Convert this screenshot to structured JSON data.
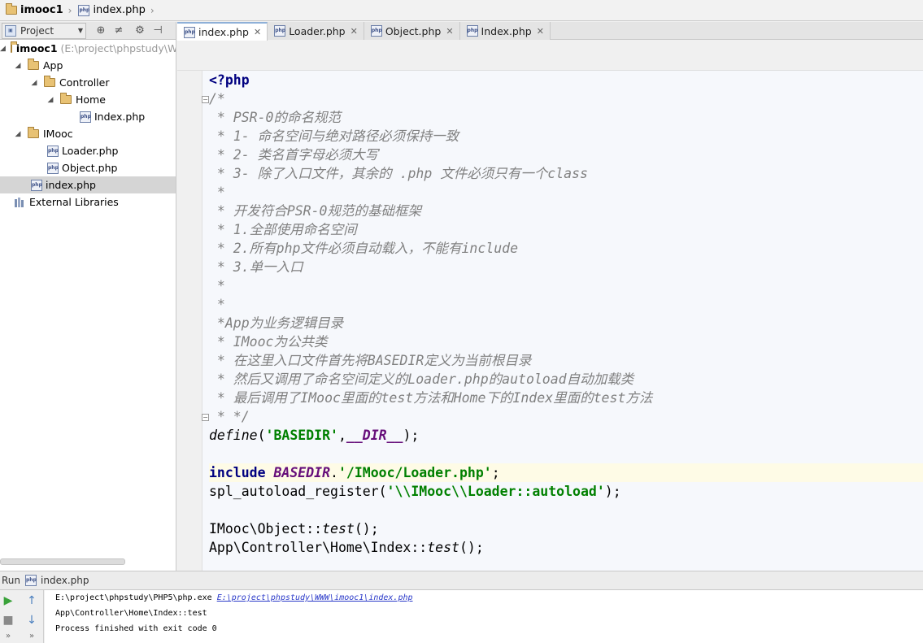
{
  "breadcrumb": {
    "project": "imooc1",
    "file": "index.php"
  },
  "project_panel": {
    "view_selector": "Project",
    "tree": [
      {
        "label": "imooc1",
        "path": "(E:\\project\\phpstudy\\W",
        "type": "folder",
        "expanded": true
      },
      {
        "label": "App",
        "type": "folder",
        "expanded": true
      },
      {
        "label": "Controller",
        "type": "folder",
        "expanded": true
      },
      {
        "label": "Home",
        "type": "folder",
        "expanded": true
      },
      {
        "label": "Index.php",
        "type": "php-file"
      },
      {
        "label": "IMooc",
        "type": "folder",
        "expanded": true
      },
      {
        "label": "Loader.php",
        "type": "php-file"
      },
      {
        "label": "Object.php",
        "type": "php-file"
      },
      {
        "label": "index.php",
        "type": "php-file",
        "selected": true
      },
      {
        "label": "External Libraries",
        "type": "library"
      }
    ]
  },
  "tabs": [
    {
      "label": "index.php",
      "active": true
    },
    {
      "label": "Loader.php"
    },
    {
      "label": "Object.php"
    },
    {
      "label": "Index.php"
    }
  ],
  "editor": {
    "lines": [
      "<?php",
      "/*",
      " * PSR-0的命名规范",
      " * 1- 命名空间与绝对路径必须保持一致",
      " * 2- 类名首字母必须大写",
      " * 3- 除了入口文件，其余的 .php 文件必须只有一个class",
      " *",
      " * 开发符合PSR-0规范的基础框架",
      " * 1.全部使用命名空间",
      " * 2.所有php文件必须自动载入，不能有include",
      " * 3.单一入口",
      " *",
      " *",
      " *App为业务逻辑目录",
      " * IMooc为公共类",
      " * 在这里入口文件首先将BASEDIR定义为当前根目录",
      " * 然后又调用了命名空间定义的Loader.php的autoload自动加载类",
      " * 最后调用了IMooc里面的test方法和Home下的Index里面的test方法",
      " * */",
      "define('BASEDIR',__DIR__);",
      "",
      "include BASEDIR.'/IMooc/Loader.php';",
      "spl_autoload_register('\\\\IMooc\\\\Loader::autoload');",
      "",
      "IMooc\\Object::test();",
      "App\\Controller\\Home\\Index::test();"
    ],
    "tokens": {
      "php_open": "<?php",
      "define_fn": "define",
      "define_open": "(",
      "define_arg": "'BASEDIR'",
      "comma": ",",
      "dir_const": "__DIR__",
      "define_close": ");",
      "include_kw": "include",
      "basedir_const": "BASEDIR",
      "dot": ".",
      "include_path": "'/IMooc/Loader.php'",
      "semicolon": ";",
      "spl_fn": "spl_autoload_register(",
      "spl_arg": "'\\\\IMooc\\\\Loader::autoload'",
      "spl_close": ");",
      "call1_class": "IMooc\\Object::",
      "call1_method": "test",
      "call1_end": "();",
      "call2_class": "App\\Controller\\Home\\Index::",
      "call2_method": "test",
      "call2_end": "();"
    }
  },
  "run_panel": {
    "label": "Run",
    "config_file": "index.php",
    "console": {
      "command": "E:\\project\\phpstudy\\PHP5\\php.exe",
      "script_link": "E:\\project\\phpstudy\\WWW\\imooc1\\index.php",
      "output": "App\\Controller\\Home\\Index::test",
      "exit": "Process finished with exit code 0"
    }
  },
  "colors": {
    "comment": "#808080",
    "keyword": "#000080",
    "string": "#008000",
    "constant": "#660e7a",
    "editor_bg": "#f6f8fc",
    "caret_line": "#fefbe6",
    "selection": "#d5d5d5"
  },
  "icons": {
    "breadcrumb_folder": "folder-icon",
    "breadcrumb_file": "php-file-icon",
    "rerun": "play-icon",
    "stop": "stop-icon",
    "up": "arrow-up-icon",
    "down": "arrow-down-icon"
  }
}
